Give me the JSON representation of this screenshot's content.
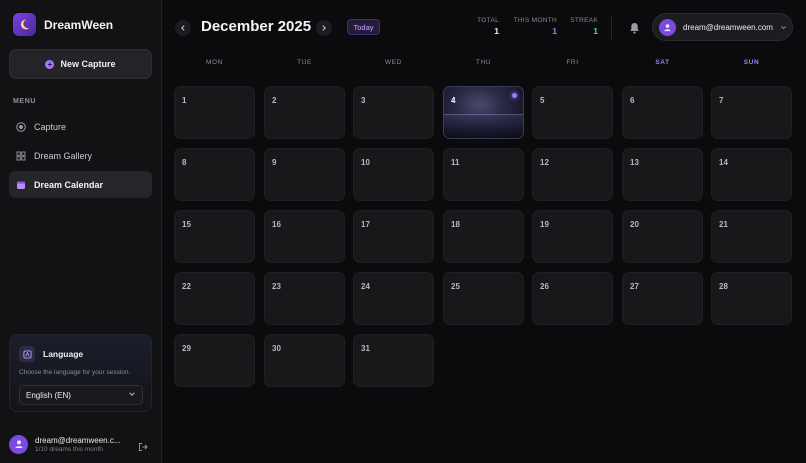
{
  "app": {
    "name": "DreamWeen"
  },
  "sidebar": {
    "new_capture_label": "New Capture",
    "menu_label": "MENU",
    "items": [
      {
        "label": "Capture",
        "icon": "capture-icon",
        "active": false
      },
      {
        "label": "Dream Gallery",
        "icon": "grid-icon",
        "active": false
      },
      {
        "label": "Dream Calendar",
        "icon": "calendar-icon",
        "active": true
      }
    ],
    "language": {
      "title": "Language",
      "description": "Choose the language for your session.",
      "selected": "English (EN)"
    },
    "user": {
      "email": "dream@dreamween.c...",
      "subtitle": "1/10 dreams this month"
    }
  },
  "header": {
    "month_title": "December 2025",
    "today_label": "Today",
    "stats": [
      {
        "label": "TOTAL",
        "value": "1",
        "color": "#f0f0f3"
      },
      {
        "label": "THIS MONTH",
        "value": "1",
        "color": "#a47cff"
      },
      {
        "label": "STREAK",
        "value": "1",
        "color": "#4ade80"
      }
    ],
    "account_email": "dream@dreamween.com"
  },
  "calendar": {
    "weekdays": [
      "MON",
      "TUE",
      "WED",
      "THU",
      "FRI",
      "SAT",
      "SUN"
    ],
    "days": [
      "1",
      "2",
      "3",
      "4",
      "5",
      "6",
      "7",
      "8",
      "9",
      "10",
      "11",
      "12",
      "13",
      "14",
      "15",
      "16",
      "17",
      "18",
      "19",
      "20",
      "21",
      "22",
      "23",
      "24",
      "25",
      "26",
      "27",
      "28",
      "29",
      "30",
      "31"
    ],
    "capture_days": [
      "4"
    ]
  },
  "colors": {
    "accent": "#a675ff",
    "background": "#0b0b0d",
    "sidebar": "#121214",
    "cell": "#18181b"
  }
}
